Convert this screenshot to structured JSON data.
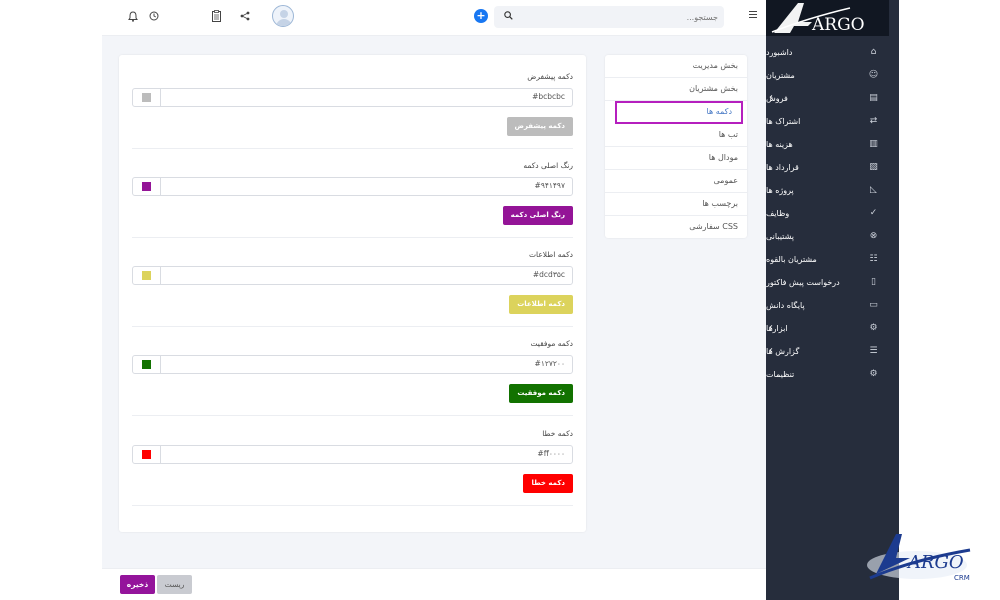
{
  "topbar": {
    "search_placeholder": "جستجو...",
    "icons": [
      "bell-icon",
      "clock-icon",
      "user-avatar",
      "clipboard-icon",
      "share-icon",
      "plus-icon",
      "search-icon",
      "menu-icon"
    ]
  },
  "sidebar": {
    "logo_text": "ARGO",
    "items": [
      {
        "label": "داشبورد",
        "icon": "⌂",
        "has_arrow": false
      },
      {
        "label": "مشتریان",
        "icon": "☺",
        "has_arrow": false
      },
      {
        "label": "فروش",
        "icon": "▤",
        "has_arrow": true
      },
      {
        "label": "اشتراک ها",
        "icon": "⇄",
        "has_arrow": false
      },
      {
        "label": "هزینه ها",
        "icon": "▥",
        "has_arrow": false
      },
      {
        "label": "قرارداد ها",
        "icon": "▧",
        "has_arrow": false
      },
      {
        "label": "پروژه ها",
        "icon": "◺",
        "has_arrow": false
      },
      {
        "label": "وظایف",
        "icon": "✓",
        "has_arrow": false
      },
      {
        "label": "پشتیبانی",
        "icon": "⊗",
        "has_arrow": false
      },
      {
        "label": "مشتریان بالقوه",
        "icon": "☷",
        "has_arrow": false
      },
      {
        "label": "درخواست پیش فاکتور",
        "icon": "▯",
        "has_arrow": false
      },
      {
        "label": "پایگاه دانش",
        "icon": "▭",
        "has_arrow": false
      },
      {
        "label": "ابزارها",
        "icon": "⚙",
        "has_arrow": true
      },
      {
        "label": "گزارش ها",
        "icon": "☰",
        "has_arrow": true
      },
      {
        "label": "تنظیمات",
        "icon": "⚙",
        "has_arrow": false
      }
    ]
  },
  "tabs": [
    {
      "label": "بخش مدیریت",
      "active": false
    },
    {
      "label": "بخش مشتریان",
      "active": false
    },
    {
      "label": "دکمه ها",
      "active": true
    },
    {
      "label": "تب ها",
      "active": false
    },
    {
      "label": "مودال ها",
      "active": false
    },
    {
      "label": "عمومی",
      "active": false
    },
    {
      "label": "برچسب ها",
      "active": false
    },
    {
      "label": "CSS سفارشی",
      "active": false
    }
  ],
  "sections": [
    {
      "title": "دکمه پیشفرض",
      "value": "#bcbcbc",
      "color": "#bcbcbc",
      "button_label": "دکمه پیشفرض"
    },
    {
      "title": "رنگ اصلی دکمه",
      "value": "#۹۴۱۴۹۷",
      "color": "#941497",
      "button_label": "رنگ اصلی دکمه"
    },
    {
      "title": "دکمه اطلاعات",
      "value": "#dcd۳۵c",
      "color": "#dcd35c",
      "button_label": "دکمه اطلاعات"
    },
    {
      "title": "دکمه موفقیت",
      "value": "#۱۲۷۲۰۰",
      "color": "#127200",
      "button_label": "دکمه موفقیت"
    },
    {
      "title": "دکمه خطا",
      "value": "#ff۰۰۰۰",
      "color": "#ff0000",
      "button_label": "دکمه خطا"
    }
  ],
  "footer": {
    "save_label": "ذخیره",
    "reset_label": "ریست"
  },
  "watermark": {
    "text": "ARGO",
    "subtext": "CRM"
  }
}
